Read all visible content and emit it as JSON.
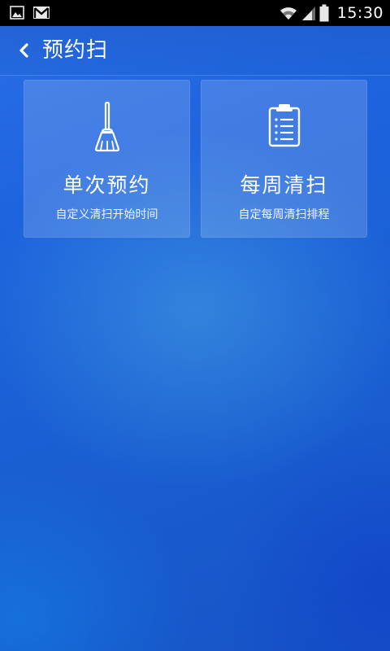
{
  "status_bar": {
    "time": "15:30",
    "left_icons": [
      "image-notification-icon",
      "gmail-icon"
    ],
    "right_icons": [
      "wifi-icon",
      "signal-icon",
      "battery-icon"
    ]
  },
  "header": {
    "back_icon": "chevron-left-icon",
    "title": "预约扫"
  },
  "cards": [
    {
      "icon": "broom-icon",
      "title": "单次预约",
      "subtitle": "自定义清扫开始时间"
    },
    {
      "icon": "clipboard-list-icon",
      "title": "每周清扫",
      "subtitle": "自定每周清扫排程"
    }
  ]
}
